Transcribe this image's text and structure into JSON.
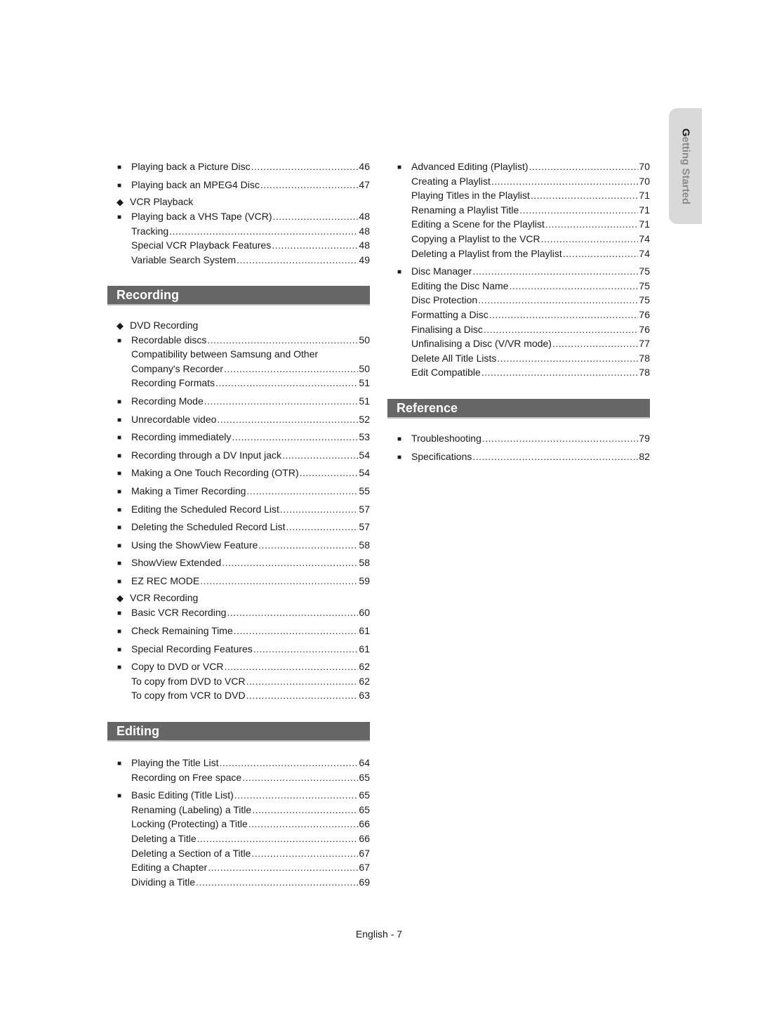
{
  "side_tab": {
    "first_letter": "G",
    "rest": "etting Started"
  },
  "footer": "English - 7",
  "left": {
    "top": [
      {
        "type": "entry",
        "bullet": true,
        "label": "Playing back a Picture Disc",
        "page": "46"
      },
      {
        "type": "entry",
        "bullet": true,
        "label": "Playing back an MPEG4 Disc",
        "page": "47",
        "gap": true
      },
      {
        "type": "group",
        "label": "VCR Playback"
      },
      {
        "type": "entry",
        "bullet": true,
        "label": "Playing back a VHS Tape (VCR)",
        "page": "48"
      },
      {
        "type": "entry",
        "bullet": false,
        "label": "Tracking",
        "page": "48"
      },
      {
        "type": "entry",
        "bullet": false,
        "label": "Special VCR Playback Features",
        "page": "48"
      },
      {
        "type": "entry",
        "bullet": false,
        "label": "Variable Search System",
        "page": "49"
      }
    ],
    "recording": {
      "title": "Recording",
      "items": [
        {
          "type": "group",
          "label": "DVD Recording"
        },
        {
          "type": "entry",
          "bullet": true,
          "label": "Recordable discs",
          "page": "50"
        },
        {
          "type": "wrap",
          "label": "Compatibility between Samsung and Other"
        },
        {
          "type": "entry",
          "bullet": false,
          "label": "Company's Recorder",
          "page": "50"
        },
        {
          "type": "entry",
          "bullet": false,
          "label": "Recording Formats",
          "page": "51"
        },
        {
          "type": "entry",
          "bullet": true,
          "label": "Recording Mode",
          "page": "51",
          "gap": true
        },
        {
          "type": "entry",
          "bullet": true,
          "label": "Unrecordable video",
          "page": "52",
          "gap": true
        },
        {
          "type": "entry",
          "bullet": true,
          "label": "Recording immediately",
          "page": "53",
          "gap": true
        },
        {
          "type": "entry",
          "bullet": true,
          "label": "Recording through a DV Input jack",
          "page": "54",
          "gap": true
        },
        {
          "type": "entry",
          "bullet": true,
          "label": "Making a One Touch Recording (OTR)",
          "page": "54",
          "gap": true
        },
        {
          "type": "entry",
          "bullet": true,
          "label": "Making a Timer Recording",
          "page": "55",
          "gap": true
        },
        {
          "type": "entry",
          "bullet": true,
          "label": "Editing the Scheduled Record List",
          "page": "57",
          "gap": true
        },
        {
          "type": "entry",
          "bullet": true,
          "label": "Deleting the Scheduled Record List",
          "page": "57",
          "gap": true
        },
        {
          "type": "entry",
          "bullet": true,
          "label": "Using the ShowView Feature",
          "page": "58",
          "gap": true
        },
        {
          "type": "entry",
          "bullet": true,
          "label": "ShowView Extended",
          "page": "58",
          "gap": true
        },
        {
          "type": "entry",
          "bullet": true,
          "label": "EZ REC MODE",
          "page": "59",
          "gap": true
        },
        {
          "type": "group",
          "label": "VCR Recording"
        },
        {
          "type": "entry",
          "bullet": true,
          "label": "Basic VCR Recording",
          "page": "60"
        },
        {
          "type": "entry",
          "bullet": true,
          "label": "Check Remaining Time",
          "page": "61",
          "gap": true
        },
        {
          "type": "entry",
          "bullet": true,
          "label": "Special Recording Features",
          "page": "61",
          "gap": true
        },
        {
          "type": "entry",
          "bullet": true,
          "label": "Copy to DVD or VCR",
          "page": "62",
          "gap": true
        },
        {
          "type": "entry",
          "bullet": false,
          "label": "To copy from DVD to VCR",
          "page": "62"
        },
        {
          "type": "entry",
          "bullet": false,
          "label": "To copy from VCR to DVD",
          "page": "63"
        }
      ]
    },
    "editing": {
      "title": "Editing",
      "items": [
        {
          "type": "entry",
          "bullet": true,
          "label": "Playing the Title List",
          "page": "64"
        },
        {
          "type": "entry",
          "bullet": false,
          "label": "Recording on Free space",
          "page": "65"
        },
        {
          "type": "entry",
          "bullet": true,
          "label": "Basic Editing (Title List)",
          "page": "65",
          "gap": true
        },
        {
          "type": "entry",
          "bullet": false,
          "label": "Renaming (Labeling) a Title",
          "page": "65"
        },
        {
          "type": "entry",
          "bullet": false,
          "label": "Locking (Protecting) a Title",
          "page": "66"
        },
        {
          "type": "entry",
          "bullet": false,
          "label": "Deleting a Title",
          "page": "66"
        },
        {
          "type": "entry",
          "bullet": false,
          "label": "Deleting a Section of a Title",
          "page": "67"
        },
        {
          "type": "entry",
          "bullet": false,
          "label": "Editing a Chapter",
          "page": "67"
        },
        {
          "type": "entry",
          "bullet": false,
          "label": "Dividing a Title",
          "page": "69"
        }
      ]
    }
  },
  "right": {
    "top": [
      {
        "type": "entry",
        "bullet": true,
        "label": "Advanced Editing (Playlist)",
        "page": "70"
      },
      {
        "type": "entry",
        "bullet": false,
        "label": "Creating a Playlist",
        "page": "70"
      },
      {
        "type": "entry",
        "bullet": false,
        "label": "Playing Titles in the Playlist",
        "page": "71"
      },
      {
        "type": "entry",
        "bullet": false,
        "label": "Renaming a Playlist Title",
        "page": "71"
      },
      {
        "type": "entry",
        "bullet": false,
        "label": "Editing a Scene for the Playlist",
        "page": "71"
      },
      {
        "type": "entry",
        "bullet": false,
        "label": "Copying a Playlist to the VCR",
        "page": "74"
      },
      {
        "type": "entry",
        "bullet": false,
        "label": "Deleting a Playlist from the Playlist",
        "page": "74"
      },
      {
        "type": "entry",
        "bullet": true,
        "label": "Disc Manager",
        "page": "75",
        "gap": true
      },
      {
        "type": "entry",
        "bullet": false,
        "label": "Editing the Disc Name",
        "page": "75"
      },
      {
        "type": "entry",
        "bullet": false,
        "label": "Disc Protection",
        "page": "75"
      },
      {
        "type": "entry",
        "bullet": false,
        "label": "Formatting a Disc",
        "page": "76"
      },
      {
        "type": "entry",
        "bullet": false,
        "label": "Finalising a Disc",
        "page": "76"
      },
      {
        "type": "entry",
        "bullet": false,
        "label": "Unfinalising a Disc (V/VR mode)",
        "page": "77"
      },
      {
        "type": "entry",
        "bullet": false,
        "label": "Delete All Title Lists",
        "page": "78"
      },
      {
        "type": "entry",
        "bullet": false,
        "label": "Edit Compatible",
        "page": "78"
      }
    ],
    "reference": {
      "title": "Reference",
      "items": [
        {
          "type": "entry",
          "bullet": true,
          "label": "Troubleshooting",
          "page": "79"
        },
        {
          "type": "entry",
          "bullet": true,
          "label": "Specifications",
          "page": "82",
          "gap": true
        }
      ]
    }
  }
}
